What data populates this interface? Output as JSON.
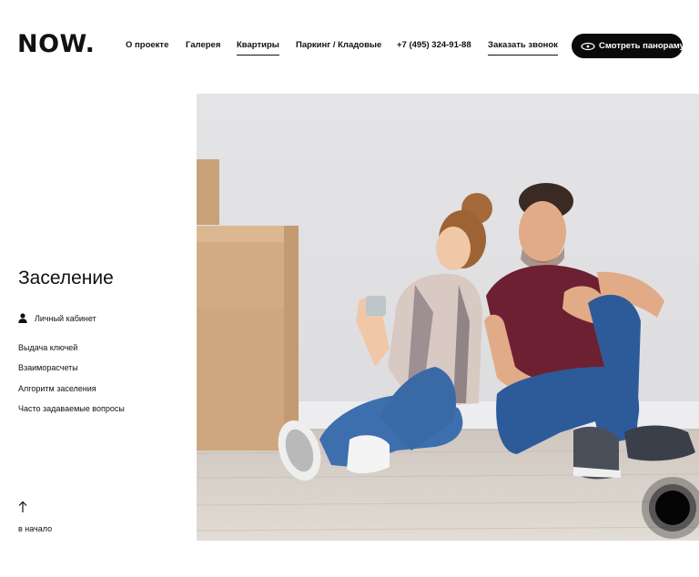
{
  "header": {
    "logo": "NOW.",
    "nav": [
      {
        "label": "О проекте",
        "underlined": false
      },
      {
        "label": "Галерея",
        "underlined": false
      },
      {
        "label": "Квартиры",
        "underlined": true
      },
      {
        "label": "Паркинг / Кладовые",
        "underlined": false
      },
      {
        "label": "+7 (495) 324-91-88",
        "underlined": false
      },
      {
        "label": "Заказать звонок",
        "underlined": true
      }
    ],
    "cta_label": "Смотреть панораму",
    "cta_icon": "360-icon"
  },
  "sidebar": {
    "title": "Заселение",
    "cabinet_label": "Личный кабинет",
    "menu": [
      "Выдача ключей",
      "Взаиморасчеты",
      "Алгоритм заселения",
      "Часто задаваемые вопросы"
    ],
    "to_top_label": "в начало"
  },
  "photo": {
    "subject": "couple-sitting-with-boxes"
  },
  "colors": {
    "accent": "#0a0a0a",
    "background": "#ffffff",
    "wall": "#e6e6e8"
  }
}
